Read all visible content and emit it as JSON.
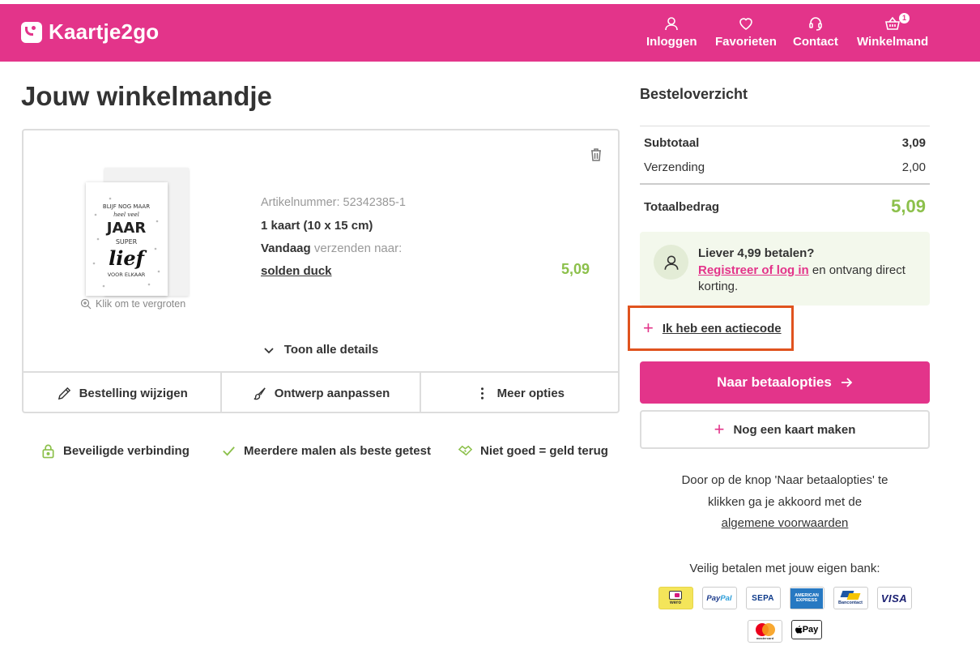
{
  "brand": {
    "name": "Kaartje2go",
    "accent": "#e3348a",
    "price_color": "#8cc04b",
    "highlight": "#e0531e"
  },
  "nav": [
    {
      "label": "Inloggen",
      "icon": "user-icon"
    },
    {
      "label": "Favorieten",
      "icon": "heart-icon"
    },
    {
      "label": "Contact",
      "icon": "headset-icon"
    },
    {
      "label": "Winkelmand",
      "icon": "basket-icon",
      "badge": "1"
    }
  ],
  "page_title": "Jouw winkelmandje",
  "item": {
    "thumb_text": [
      "BLIJF NOG MAAR",
      "heel veel",
      "JAAR",
      "SUPER",
      "lief",
      "VOOR ELKAAR"
    ],
    "zoom_hint": "Klik om te vergroten",
    "article_number": "Artikelnummer: 52342385-1",
    "size": "1 kaart (10 x 15 cm)",
    "ship_day": "Vandaag",
    "ship_text": "verzenden naar:",
    "recipient": "solden duck",
    "price": "5,09",
    "show_details": "Toon alle details",
    "actions": [
      "Bestelling wijzigen",
      "Ontwerp aanpassen",
      "Meer opties"
    ]
  },
  "trust": [
    "Beveiligde verbinding",
    "Meerdere malen als beste getest",
    "Niet goed = geld terug"
  ],
  "summary": {
    "title": "Besteloverzicht",
    "subtotal_label": "Subtotaal",
    "subtotal": "3,09",
    "shipping_label": "Verzending",
    "shipping": "2,00",
    "total_label": "Totaalbedrag",
    "total": "5,09"
  },
  "promo": {
    "title": "Liever 4,99 betalen?",
    "link": "Registreer of log in",
    "text": " en ontvang direct korting."
  },
  "actiecode": "Ik heb een actiecode",
  "pay_button": "Naar betaalopties",
  "new_card_button": "Nog een kaart maken",
  "terms": {
    "line1": "Door op de knop 'Naar betaalopties' te",
    "line2": "klikken ga je akkoord met de",
    "link": "algemene voorwaarden"
  },
  "bank_label": "Veilig betalen met jouw eigen bank:",
  "payment_methods": {
    "wero": "wero",
    "paypal_a": "Pay",
    "paypal_b": "Pal",
    "sepa": "SEPA",
    "amex": "AMERICAN EXPRESS",
    "bancontact": "Bancontact",
    "visa": "VISA",
    "mastercard": "mastercard",
    "applepay": "Pay"
  }
}
